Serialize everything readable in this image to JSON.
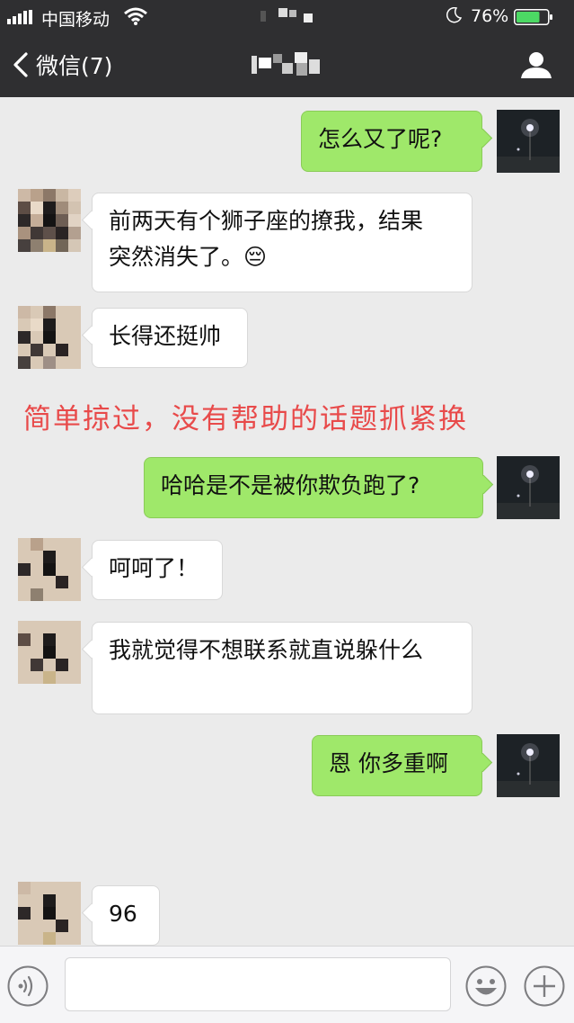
{
  "status_bar": {
    "carrier": "中国移动",
    "battery_percent": "76%",
    "battery_level": 0.76
  },
  "nav": {
    "back_label": "微信(7)"
  },
  "messages": [
    {
      "side": "right",
      "text": "怎么又了呢?"
    },
    {
      "side": "left",
      "line1": "前两天有个狮子座的撩我，结果",
      "line2": "突然消失了。😔"
    },
    {
      "side": "left",
      "text": "长得还挺帅"
    },
    {
      "side": "right",
      "text": "哈哈是不是被你欺负跑了?"
    },
    {
      "side": "left",
      "text": "呵呵了！"
    },
    {
      "side": "left",
      "text": "我就觉得不想联系就直说躲什么"
    },
    {
      "side": "right",
      "text": "恩 你多重啊"
    },
    {
      "side": "left",
      "text": "96"
    }
  ],
  "annotation": "简单掠过，没有帮助的话题抓紧换",
  "input": {
    "value": ""
  },
  "colors": {
    "header_bg": "#2f2f31",
    "chat_bg": "#ebebeb",
    "sent_bubble": "#9fe86a",
    "received_bubble": "#ffffff",
    "annotation": "#e84a4a",
    "battery": "#4cd964"
  },
  "icons": [
    "signal-icon",
    "wifi-icon",
    "moon-icon",
    "battery-icon",
    "back-chevron-icon",
    "profile-icon",
    "voice-icon",
    "emoji-icon",
    "plus-icon"
  ]
}
